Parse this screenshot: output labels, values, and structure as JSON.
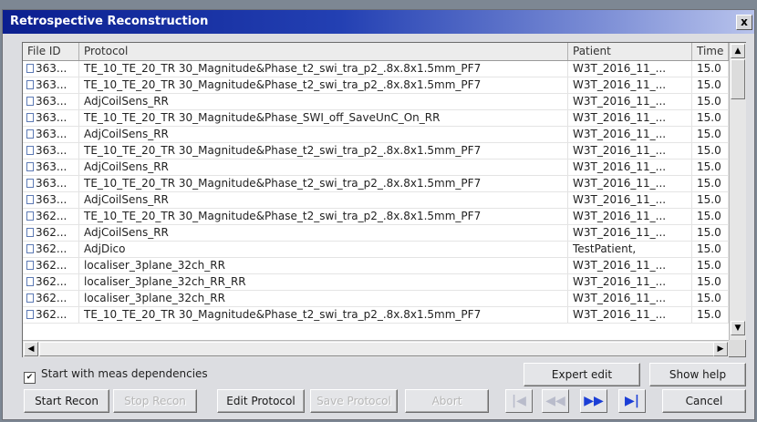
{
  "window": {
    "title": "Retrospective Reconstruction",
    "close_label": "x"
  },
  "table": {
    "headers": [
      "File ID",
      "Protocol",
      "Patient",
      "Time"
    ],
    "rows": [
      {
        "id": "363...",
        "protocol": "TE_10_TE_20_TR 30_Magnitude&Phase_t2_swi_tra_p2_.8x.8x1.5mm_PF7",
        "patient": "W3T_2016_11_...",
        "time": "15.0"
      },
      {
        "id": "363...",
        "protocol": "TE_10_TE_20_TR 30_Magnitude&Phase_t2_swi_tra_p2_.8x.8x1.5mm_PF7",
        "patient": "W3T_2016_11_...",
        "time": "15.0"
      },
      {
        "id": "363...",
        "protocol": "AdjCoilSens_RR",
        "patient": "W3T_2016_11_...",
        "time": "15.0"
      },
      {
        "id": "363...",
        "protocol": "TE_10_TE_20_TR 30_Magnitude&Phase_SWI_off_SaveUnC_On_RR",
        "patient": "W3T_2016_11_...",
        "time": "15.0"
      },
      {
        "id": "363...",
        "protocol": "AdjCoilSens_RR",
        "patient": "W3T_2016_11_...",
        "time": "15.0"
      },
      {
        "id": "363...",
        "protocol": "TE_10_TE_20_TR 30_Magnitude&Phase_t2_swi_tra_p2_.8x.8x1.5mm_PF7",
        "patient": "W3T_2016_11_...",
        "time": "15.0"
      },
      {
        "id": "363...",
        "protocol": "AdjCoilSens_RR",
        "patient": "W3T_2016_11_...",
        "time": "15.0"
      },
      {
        "id": "363...",
        "protocol": "TE_10_TE_20_TR 30_Magnitude&Phase_t2_swi_tra_p2_.8x.8x1.5mm_PF7",
        "patient": "W3T_2016_11_...",
        "time": "15.0"
      },
      {
        "id": "363...",
        "protocol": "AdjCoilSens_RR",
        "patient": "W3T_2016_11_...",
        "time": "15.0"
      },
      {
        "id": "362...",
        "protocol": "TE_10_TE_20_TR 30_Magnitude&Phase_t2_swi_tra_p2_.8x.8x1.5mm_PF7",
        "patient": "W3T_2016_11_...",
        "time": "15.0"
      },
      {
        "id": "362...",
        "protocol": "AdjCoilSens_RR",
        "patient": "W3T_2016_11_...",
        "time": "15.0"
      },
      {
        "id": "362...",
        "protocol": "AdjDico",
        "patient": "TestPatient,",
        "time": "15.0"
      },
      {
        "id": "362...",
        "protocol": "localiser_3plane_32ch_RR",
        "patient": "W3T_2016_11_...",
        "time": "15.0"
      },
      {
        "id": "362...",
        "protocol": "localiser_3plane_32ch_RR_RR",
        "patient": "W3T_2016_11_...",
        "time": "15.0"
      },
      {
        "id": "362...",
        "protocol": "localiser_3plane_32ch_RR",
        "patient": "W3T_2016_11_...",
        "time": "15.0"
      },
      {
        "id": "362...",
        "protocol": "TE_10_TE_20_TR 30_Magnitude&Phase_t2_swi_tra_p2_.8x.8x1.5mm_PF7",
        "patient": "W3T_2016_11_...",
        "time": "15.0"
      }
    ]
  },
  "options": {
    "meas_dependencies_label": "Start with meas dependencies",
    "meas_dependencies_checked": "✔"
  },
  "buttons": {
    "expert_edit": "Expert edit",
    "show_help": "Show help",
    "start_recon": "Start Recon",
    "stop_recon": "Stop Recon",
    "edit_protocol": "Edit Protocol",
    "save_protocol": "Save Protocol",
    "abort": "Abort",
    "cancel": "Cancel"
  },
  "nav": {
    "first": "|◀",
    "prev": "◀◀",
    "next": "▶▶",
    "last": "▶|"
  },
  "scroll": {
    "up": "▲",
    "down": "▼",
    "left": "◀",
    "right": "▶"
  }
}
